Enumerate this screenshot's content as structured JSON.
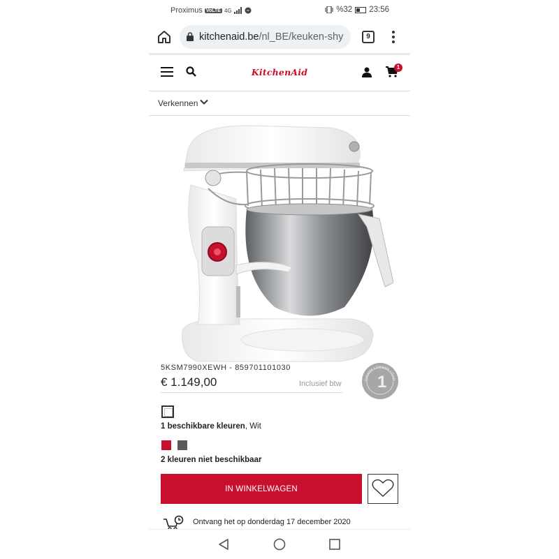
{
  "status_bar": {
    "carrier": "Proximus",
    "volte": "VoLTE",
    "network": "4G",
    "battery": "%32",
    "time": "23:56"
  },
  "browser": {
    "url_host": "kitchenaid.be",
    "url_path": "/nl_BE/keuken-shy",
    "tab_count": "9"
  },
  "site_header": {
    "logo": "KitchenAid",
    "cart_count": "1"
  },
  "explore": {
    "label": "Verkennen"
  },
  "product": {
    "sku": "5KSM7990XEWH - 859701101030",
    "price": "€ 1.149,00",
    "tax_note": "Inclusief btw",
    "guarantee_text": "Garantie • Garantie • Guarantee",
    "guarantee_year": "1"
  },
  "colors": {
    "available_count_label": "1 beschikbare kleuren",
    "selected_color": ", Wit",
    "unavailable_label": "2 kleuren niet beschikbaar",
    "swatches": [
      {
        "name": "red-swatch",
        "hex": "#c8102e"
      },
      {
        "name": "grey-swatch",
        "hex": "#5a5a5a"
      }
    ]
  },
  "actions": {
    "add_to_cart": "IN WINKELWAGEN"
  },
  "delivery": {
    "text": "Ontvang het op donderdag 17 december 2020"
  },
  "theme": {
    "brand_red": "#c8102e"
  }
}
